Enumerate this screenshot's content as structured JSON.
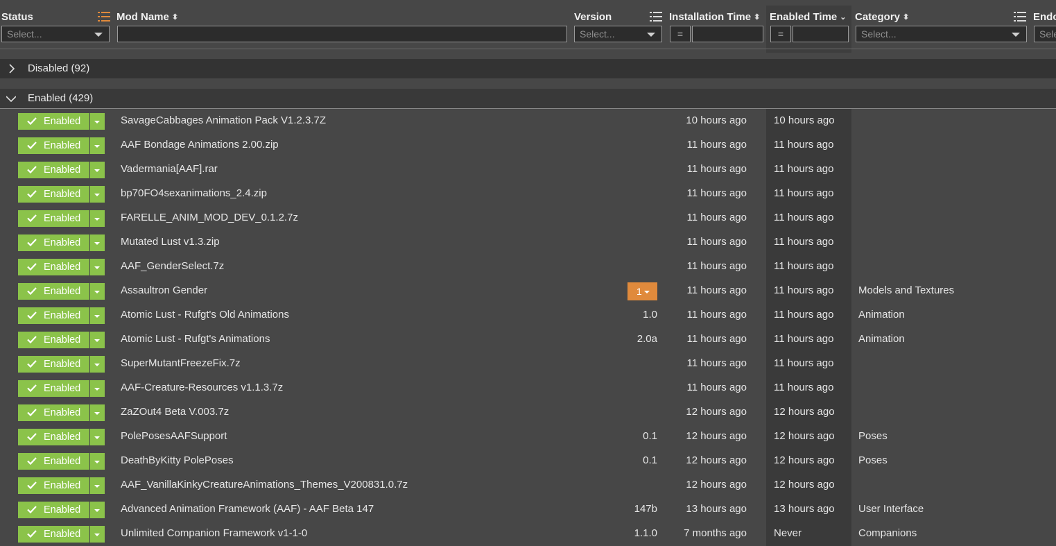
{
  "header": {
    "status": {
      "title": "Status",
      "placeholder": "Select..."
    },
    "mod_name": {
      "title": "Mod Name",
      "value": ""
    },
    "version": {
      "title": "Version",
      "placeholder": "Select..."
    },
    "installation_time": {
      "title": "Installation Time",
      "operator": "="
    },
    "enabled_time": {
      "title": "Enabled Time",
      "operator": "="
    },
    "category": {
      "title": "Category",
      "placeholder": "Select..."
    },
    "endorsed": {
      "title": "Endo",
      "placeholder": "Sele"
    }
  },
  "groups": {
    "disabled": {
      "label": "Disabled (92)",
      "expanded": false
    },
    "enabled": {
      "label": "Enabled (429)",
      "expanded": true
    }
  },
  "colors": {
    "enabled_green": "#8bc34a",
    "update_orange": "#e08a3c",
    "accent_icon": "#e08a3c"
  },
  "rows": [
    {
      "status": "Enabled",
      "name": "SavageCabbages Animation Pack V1.2.3.7Z",
      "version": "",
      "installed": "10 hours ago",
      "enabled": "10 hours ago",
      "category": ""
    },
    {
      "status": "Enabled",
      "name": "AAF Bondage Animations 2.00.zip",
      "version": "",
      "installed": "11 hours ago",
      "enabled": "11 hours ago",
      "category": ""
    },
    {
      "status": "Enabled",
      "name": "Vadermania[AAF].rar",
      "version": "",
      "installed": "11 hours ago",
      "enabled": "11 hours ago",
      "category": ""
    },
    {
      "status": "Enabled",
      "name": "bp70FO4sexanimations_2.4.zip",
      "version": "",
      "installed": "11 hours ago",
      "enabled": "11 hours ago",
      "category": ""
    },
    {
      "status": "Enabled",
      "name": "FARELLE_ANIM_MOD_DEV_0.1.2.7z",
      "version": "",
      "installed": "11 hours ago",
      "enabled": "11 hours ago",
      "category": ""
    },
    {
      "status": "Enabled",
      "name": "Mutated Lust v1.3.zip",
      "version": "",
      "installed": "11 hours ago",
      "enabled": "11 hours ago",
      "category": ""
    },
    {
      "status": "Enabled",
      "name": "AAF_GenderSelect.7z",
      "version": "",
      "installed": "11 hours ago",
      "enabled": "11 hours ago",
      "category": ""
    },
    {
      "status": "Enabled",
      "name": "Assaultron Gender",
      "version": "",
      "version_badge": "1",
      "installed": "11 hours ago",
      "enabled": "11 hours ago",
      "category": "Models and Textures"
    },
    {
      "status": "Enabled",
      "name": "Atomic Lust - Rufgt's Old Animations",
      "version": "1.0",
      "installed": "11 hours ago",
      "enabled": "11 hours ago",
      "category": "Animation"
    },
    {
      "status": "Enabled",
      "name": "Atomic Lust - Rufgt's Animations",
      "version": "2.0a",
      "installed": "11 hours ago",
      "enabled": "11 hours ago",
      "category": "Animation"
    },
    {
      "status": "Enabled",
      "name": "SuperMutantFreezeFix.7z",
      "version": "",
      "installed": "11 hours ago",
      "enabled": "11 hours ago",
      "category": ""
    },
    {
      "status": "Enabled",
      "name": "AAF-Creature-Resources v1.1.3.7z",
      "version": "",
      "installed": "11 hours ago",
      "enabled": "11 hours ago",
      "category": ""
    },
    {
      "status": "Enabled",
      "name": "ZaZOut4 Beta V.003.7z",
      "version": "",
      "installed": "12 hours ago",
      "enabled": "12 hours ago",
      "category": ""
    },
    {
      "status": "Enabled",
      "name": "PolePosesAAFSupport",
      "version": "0.1",
      "installed": "12 hours ago",
      "enabled": "12 hours ago",
      "category": "Poses"
    },
    {
      "status": "Enabled",
      "name": "DeathByKitty PolePoses",
      "version": "0.1",
      "installed": "12 hours ago",
      "enabled": "12 hours ago",
      "category": "Poses"
    },
    {
      "status": "Enabled",
      "name": "AAF_VanillaKinkyCreatureAnimations_Themes_V200831.0.7z",
      "version": "",
      "installed": "12 hours ago",
      "enabled": "12 hours ago",
      "category": ""
    },
    {
      "status": "Enabled",
      "name": "Advanced Animation Framework (AAF) - AAF Beta 147",
      "version": "147b",
      "installed": "13 hours ago",
      "enabled": "13 hours ago",
      "category": "User Interface"
    },
    {
      "status": "Enabled",
      "name": "Unlimited Companion Framework v1-1-0",
      "version": "1.1.0",
      "installed": "7 months ago",
      "enabled": "Never",
      "category": "Companions"
    }
  ]
}
